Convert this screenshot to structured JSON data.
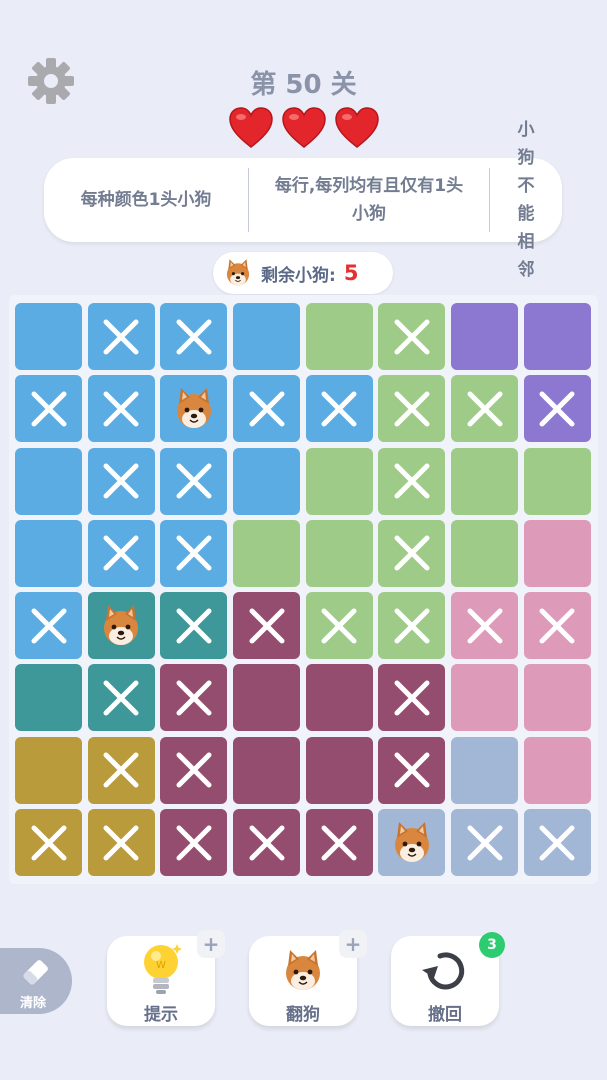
{
  "header": {
    "level_title": "第 50 关",
    "lives": 3
  },
  "rules": [
    "每种颜色1头小狗",
    "每行,每列均有且仅有1头小狗",
    "小狗不能相邻"
  ],
  "remaining": {
    "label": "剩余小狗:",
    "count": "5"
  },
  "colors": {
    "B": "#5cace4",
    "G": "#9ecc88",
    "P": "#8c78d0",
    "K": "#de9ab9",
    "T": "#3e9799",
    "M": "#944d6f",
    "Y": "#b99b3c",
    "S": "#a2b6d6"
  },
  "board": {
    "regions": [
      [
        "B",
        "B",
        "B",
        "B",
        "G",
        "G",
        "P",
        "P"
      ],
      [
        "B",
        "B",
        "B",
        "B",
        "B",
        "G",
        "G",
        "P"
      ],
      [
        "B",
        "B",
        "B",
        "B",
        "G",
        "G",
        "G",
        "G"
      ],
      [
        "B",
        "B",
        "B",
        "G",
        "G",
        "G",
        "G",
        "K"
      ],
      [
        "B",
        "T",
        "T",
        "M",
        "G",
        "G",
        "K",
        "K"
      ],
      [
        "T",
        "T",
        "M",
        "M",
        "M",
        "M",
        "K",
        "K"
      ],
      [
        "Y",
        "Y",
        "M",
        "M",
        "M",
        "M",
        "S",
        "K"
      ],
      [
        "Y",
        "Y",
        "M",
        "M",
        "M",
        "S",
        "S",
        "S"
      ]
    ],
    "marks": [
      [
        ".",
        "x",
        "x",
        ".",
        ".",
        "x",
        ".",
        "."
      ],
      [
        "x",
        "x",
        "d",
        "x",
        "x",
        "x",
        "x",
        "x"
      ],
      [
        ".",
        "x",
        "x",
        ".",
        ".",
        "x",
        ".",
        "."
      ],
      [
        ".",
        "x",
        "x",
        ".",
        ".",
        "x",
        ".",
        "."
      ],
      [
        "x",
        "d",
        "x",
        "x",
        "x",
        "x",
        "x",
        "x"
      ],
      [
        ".",
        "x",
        "x",
        ".",
        ".",
        "x",
        ".",
        "."
      ],
      [
        ".",
        "x",
        "x",
        ".",
        ".",
        "x",
        ".",
        "."
      ],
      [
        "x",
        "x",
        "x",
        "x",
        "x",
        "d",
        "x",
        "x"
      ]
    ]
  },
  "toolbar": {
    "clear_label": "清除",
    "hint_label": "提示",
    "flip_label": "翻狗",
    "undo_label": "撤回",
    "undo_count": "3",
    "plus": "+"
  }
}
